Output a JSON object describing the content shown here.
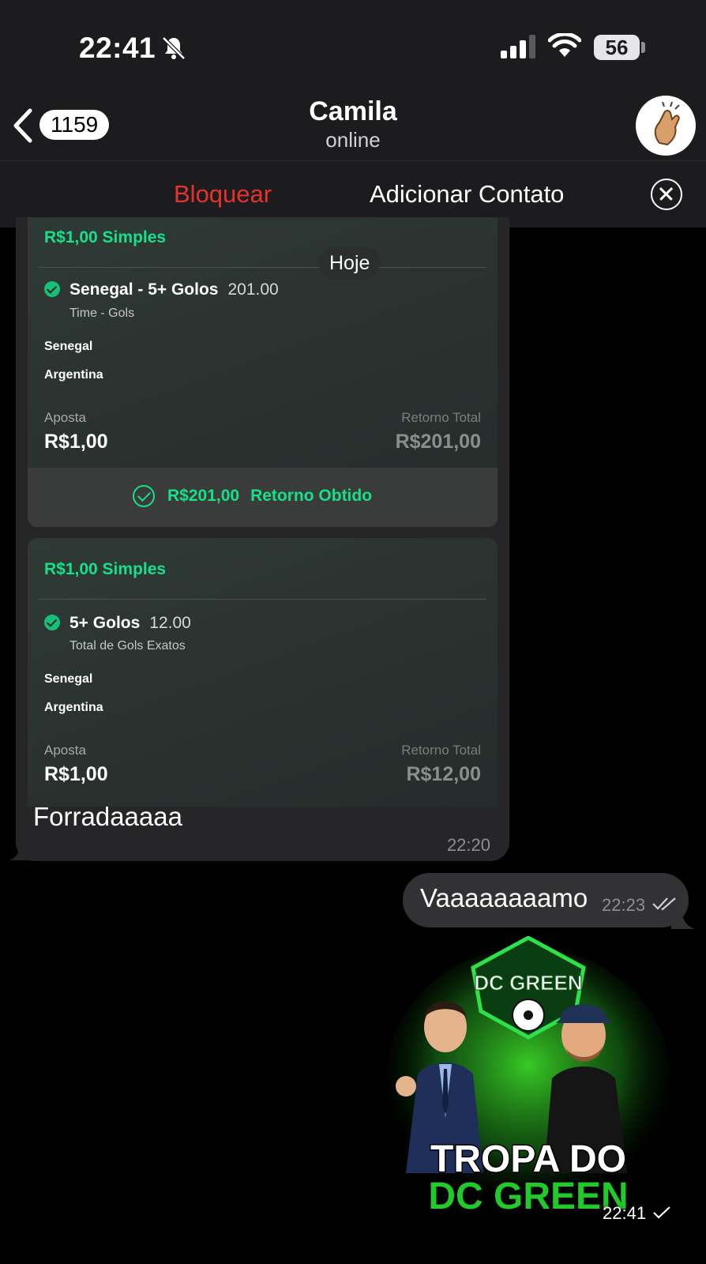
{
  "status_bar": {
    "time": "22:41",
    "battery": "56"
  },
  "nav": {
    "back_count": "1159",
    "contact_name": "Camila",
    "contact_status": "online"
  },
  "actions": {
    "block": "Bloquear",
    "add_contact": "Adicionar Contato"
  },
  "date_separator": "Hoje",
  "messages": [
    {
      "direction": "incoming",
      "bets": [
        {
          "title": "R$1,00 Simples",
          "selection": "Senegal - 5+ Golos",
          "odds": "201.00",
          "market": "Time - Gols",
          "team_a": "Senegal",
          "team_b": "Argentina",
          "stake_label": "Aposta",
          "stake": "R$1,00",
          "return_label": "Retorno Total",
          "return_value": "R$201,00",
          "result_amount": "R$201,00",
          "result_label": "Retorno Obtido"
        },
        {
          "title": "R$1,00 Simples",
          "selection": "5+ Golos",
          "odds": "12.00",
          "market": "Total de Gols Exatos",
          "team_a": "Senegal",
          "team_b": "Argentina",
          "stake_label": "Aposta",
          "stake": "R$1,00",
          "return_label": "Retorno Total",
          "return_value": "R$12,00"
        }
      ],
      "text": "Forradaaaaa",
      "time": "22:20"
    },
    {
      "direction": "outgoing",
      "text": "Vaaaaaaaamo",
      "time": "22:23"
    },
    {
      "direction": "outgoing",
      "sticker": {
        "badge_text": "DC GREEN",
        "line1": "TROPA DO",
        "line2": "DC GREEN"
      },
      "time": "22:41"
    }
  ],
  "colors": {
    "accent_green": "#17e08a",
    "block_red": "#e5322d",
    "bubble_in": "#262628",
    "bubble_out": "#323234"
  }
}
